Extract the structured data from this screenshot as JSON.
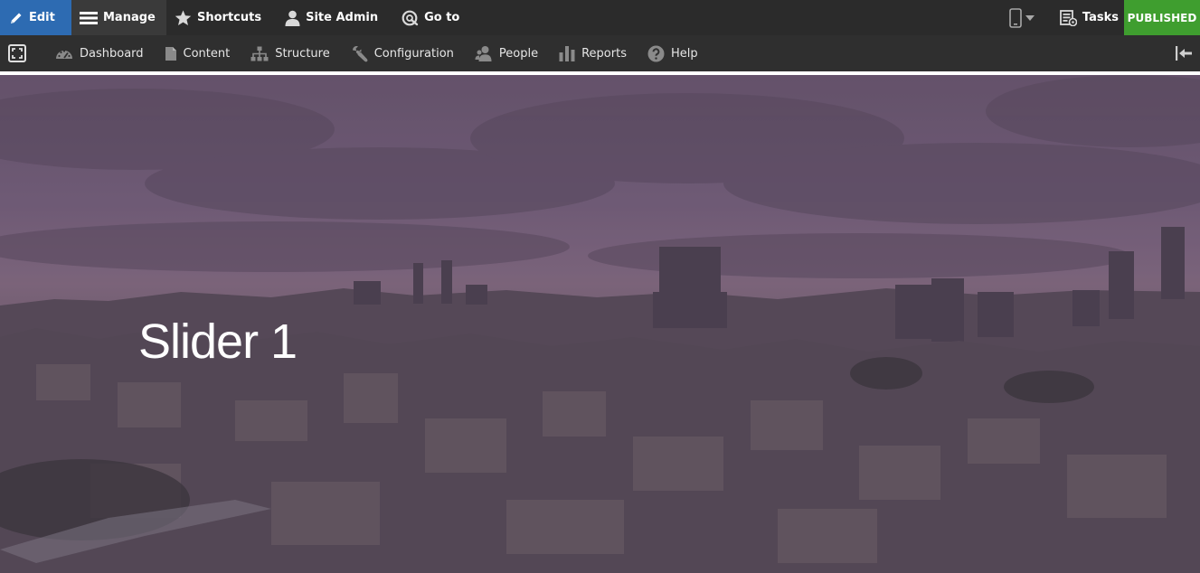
{
  "toolbar": {
    "edit_label": "Edit",
    "manage_label": "Manage",
    "shortcuts_label": "Shortcuts",
    "site_admin_label": "Site Admin",
    "goto_label": "Go to",
    "tasks_label": "Tasks",
    "status_label": "PUBLISHED"
  },
  "tray": {
    "items": [
      {
        "label": "Dashboard",
        "icon": "dashboard-icon"
      },
      {
        "label": "Content",
        "icon": "document-icon"
      },
      {
        "label": "Structure",
        "icon": "sitemap-icon"
      },
      {
        "label": "Configuration",
        "icon": "wrench-icon"
      },
      {
        "label": "People",
        "icon": "people-icon"
      },
      {
        "label": "Reports",
        "icon": "bar-chart-icon"
      },
      {
        "label": "Help",
        "icon": "help-icon"
      }
    ]
  },
  "hero": {
    "title": "Slider 1"
  },
  "colors": {
    "toolbar_bg": "#2b2b2b",
    "edit_bg": "#2d6bb2",
    "published_bg": "#3f9e2f",
    "tray_bg": "#2f2f2f"
  }
}
